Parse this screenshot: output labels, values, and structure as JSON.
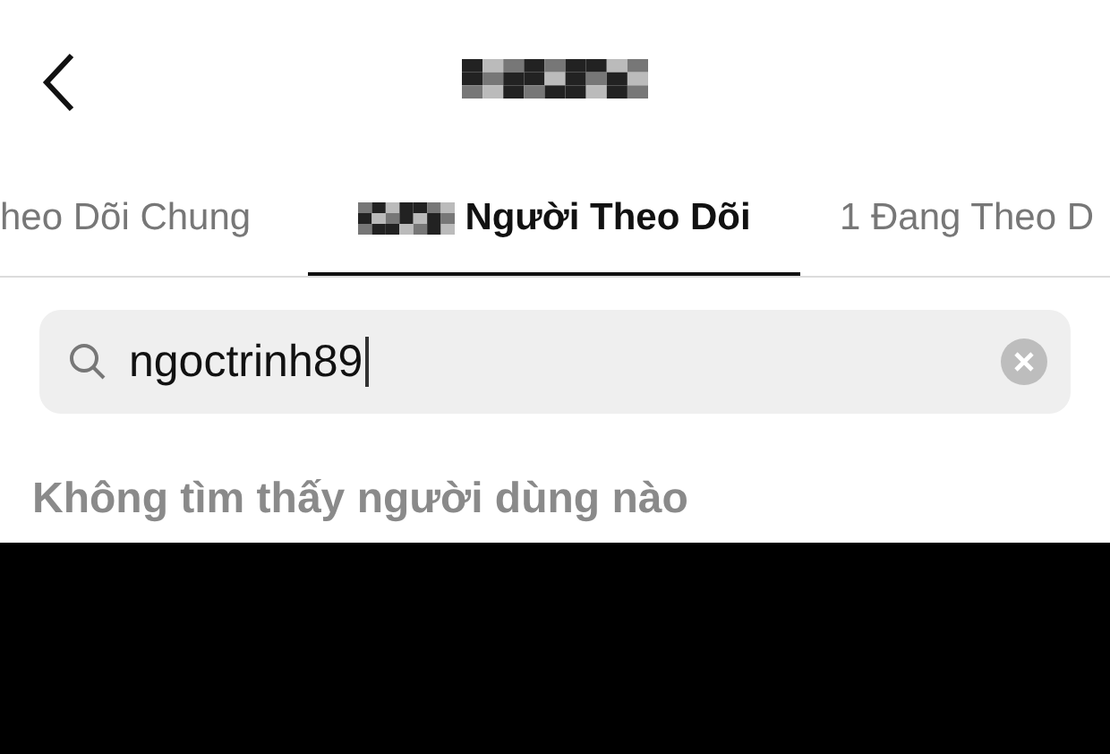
{
  "header": {
    "title_redacted": true
  },
  "tabs": [
    {
      "label": "heo Dõi Chung",
      "selected": false,
      "redacted": false
    },
    {
      "label": "Người Theo Dõi",
      "selected": true,
      "redacted": true
    },
    {
      "label": "1 Đang Theo D",
      "selected": false,
      "redacted": false
    }
  ],
  "search": {
    "value": "ngoctrinh89",
    "focused": true
  },
  "message": "Không tìm thấy người dùng nào"
}
